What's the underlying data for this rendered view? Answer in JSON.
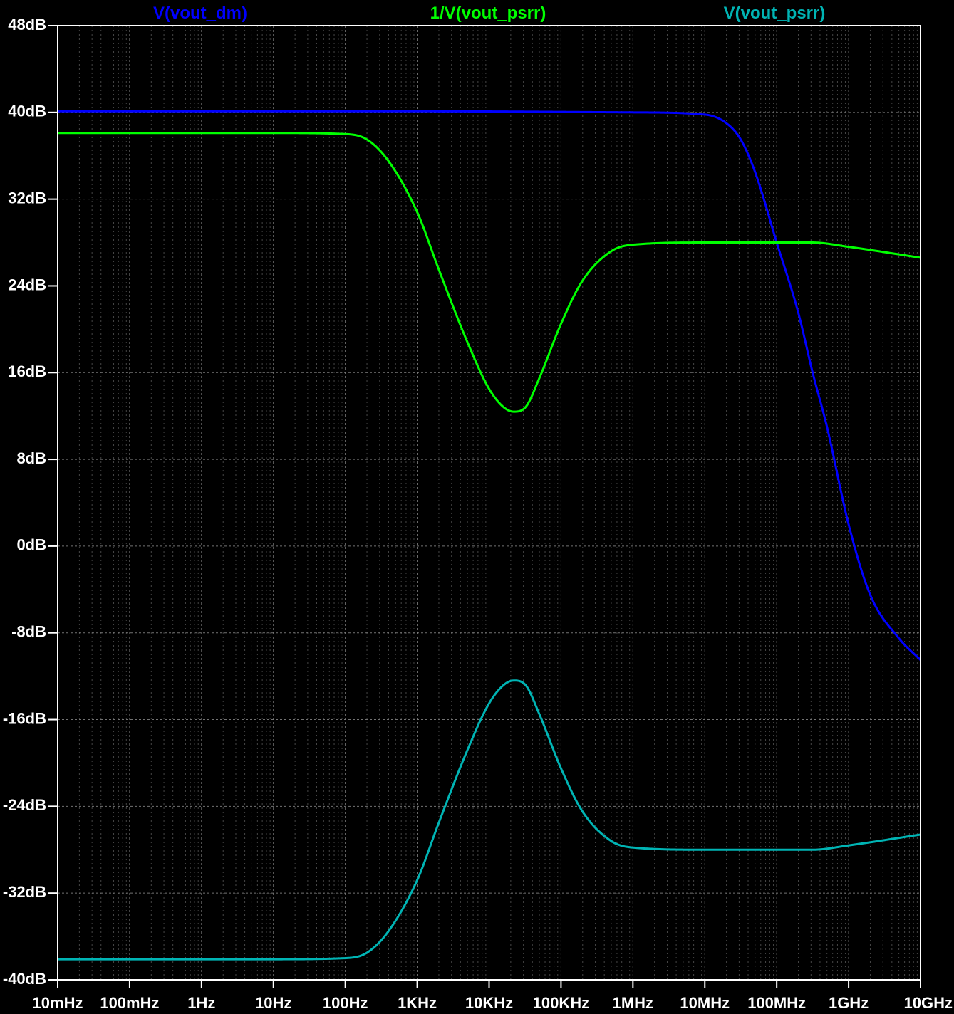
{
  "chart_data": {
    "type": "line",
    "x_scale": "log",
    "xlim": [
      0.01,
      10000000000
    ],
    "ylim": [
      -40,
      48
    ],
    "grid": true,
    "legend_placement": "top",
    "background": "#000000",
    "axis_color": "#ffffff",
    "grid_color": "#808080",
    "x_ticks": [
      {
        "value": 0.01,
        "label": "10mHz"
      },
      {
        "value": 0.1,
        "label": "100mHz"
      },
      {
        "value": 1,
        "label": "1Hz"
      },
      {
        "value": 10,
        "label": "10Hz"
      },
      {
        "value": 100,
        "label": "100Hz"
      },
      {
        "value": 1000,
        "label": "1KHz"
      },
      {
        "value": 10000,
        "label": "10KHz"
      },
      {
        "value": 100000,
        "label": "100KHz"
      },
      {
        "value": 1000000,
        "label": "1MHz"
      },
      {
        "value": 10000000,
        "label": "10MHz"
      },
      {
        "value": 100000000,
        "label": "100MHz"
      },
      {
        "value": 1000000000,
        "label": "1GHz"
      },
      {
        "value": 10000000000,
        "label": "10GHz"
      }
    ],
    "y_ticks": [
      {
        "value": 48,
        "label": "48dB"
      },
      {
        "value": 40,
        "label": "40dB"
      },
      {
        "value": 32,
        "label": "32dB"
      },
      {
        "value": 24,
        "label": "24dB"
      },
      {
        "value": 16,
        "label": "16dB"
      },
      {
        "value": 8,
        "label": "8dB"
      },
      {
        "value": 0,
        "label": "0dB"
      },
      {
        "value": -8,
        "label": "-8dB"
      },
      {
        "value": -16,
        "label": "-16dB"
      },
      {
        "value": -24,
        "label": "-24dB"
      },
      {
        "value": -32,
        "label": "-32dB"
      },
      {
        "value": -40,
        "label": "-40dB"
      }
    ],
    "series": [
      {
        "name": "V(vout_dm)",
        "color": "#0000ff",
        "x": [
          0.01,
          1000,
          1000000,
          10000000,
          20000000,
          31600000,
          50000000,
          100000000,
          200000000,
          316000000,
          500000000,
          1000000000,
          2000000000,
          5000000000,
          10000000000
        ],
        "y": [
          40.1,
          40.1,
          40.0,
          39.8,
          39.0,
          37.5,
          34.5,
          28.0,
          21.5,
          16.0,
          11.0,
          2.0,
          -4.5,
          -8.5,
          -10.5
        ]
      },
      {
        "name": "1/V(vout_psrr)",
        "color": "#00ff00",
        "x": [
          0.01,
          10,
          100,
          200,
          400,
          1000,
          2000,
          5000,
          10000,
          16000,
          22000,
          32000,
          50000,
          100000,
          200000,
          500000,
          1000000,
          10000000,
          100000000,
          316000000,
          1000000000,
          10000000000
        ],
        "y": [
          38.1,
          38.1,
          38.0,
          37.5,
          35.5,
          30.8,
          25.5,
          18.8,
          14.5,
          12.8,
          12.4,
          12.8,
          15.5,
          20.5,
          24.5,
          27.2,
          27.8,
          28.0,
          28.0,
          28.0,
          27.6,
          26.6
        ]
      },
      {
        "name": "V(vout_psrr)",
        "color": "#00b4b4",
        "x": [
          0.01,
          10,
          100,
          200,
          400,
          1000,
          2000,
          5000,
          10000,
          16000,
          22000,
          32000,
          50000,
          100000,
          200000,
          500000,
          1000000,
          10000000,
          100000000,
          316000000,
          1000000000,
          10000000000
        ],
        "y": [
          -38.1,
          -38.1,
          -38.0,
          -37.5,
          -35.5,
          -30.8,
          -25.5,
          -18.8,
          -14.5,
          -12.8,
          -12.4,
          -12.8,
          -15.5,
          -20.5,
          -24.5,
          -27.2,
          -27.8,
          -28.0,
          -28.0,
          -28.0,
          -27.6,
          -26.6
        ]
      }
    ]
  }
}
